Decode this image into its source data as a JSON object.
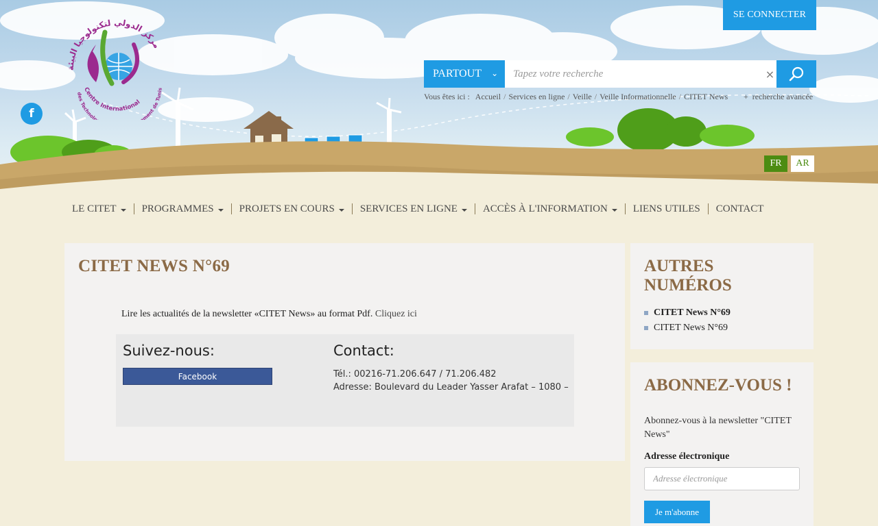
{
  "header": {
    "connect_label": "SE CONNECTER",
    "logo": {
      "arabic_arc": "مركز الدولي لتكنولوجيا البيئة",
      "name_lines": [
        "Centre International",
        "des Technologies de l'Environnement de Tunis"
      ]
    },
    "facebook_icon_glyph": "f",
    "search": {
      "scope_label": "PARTOUT",
      "scope_chevron": "⌄",
      "placeholder": "Tapez votre recherche",
      "clear_glyph": "×"
    },
    "breadcrumb": {
      "label": "Vous êtes ici :",
      "items": [
        "Accueil",
        "Services en ligne",
        "Veille",
        "Veille Informationnelle",
        "CITET News"
      ],
      "separator": "/"
    },
    "advanced_search": {
      "plus": "+",
      "label": "recherche avancée"
    },
    "languages": [
      "FR",
      "AR"
    ]
  },
  "nav": {
    "items": [
      {
        "label": "LE CITET",
        "dropdown": true
      },
      {
        "label": "PROGRAMMES",
        "dropdown": true
      },
      {
        "label": "PROJETS EN COURS",
        "dropdown": true
      },
      {
        "label": "SERVICES EN LIGNE",
        "dropdown": true
      },
      {
        "label": "ACCÈS À L'INFORMATION",
        "dropdown": true
      },
      {
        "label": "LIENS UTILES",
        "dropdown": false
      },
      {
        "label": "CONTACT",
        "dropdown": false
      }
    ]
  },
  "main": {
    "title": "CITET NEWS N°69",
    "intro_text": "Lire les actualités de la newsletter «CITET News» au format Pdf.",
    "intro_link": "Cliquez ici",
    "follow_title": "Suivez-nous:",
    "facebook_button": "Facebook",
    "contact_title": "Contact:",
    "contact_phone": "Tél.: 00216-71.206.647 / 71.206.482",
    "contact_address": "Adresse: Boulevard du Leader Yasser Arafat – 1080 –"
  },
  "sidebar": {
    "other_issues_title": "AUTRES NUMÉROS",
    "issues": [
      "CITET News N°69",
      "CITET News N°69"
    ],
    "subscribe_title": "ABONNEZ-VOUS !",
    "subscribe_text": "Abonnez-vous à la newsletter \"CITET News\"",
    "email_label": "Adresse électronique",
    "email_placeholder": "Adresse électronique",
    "subscribe_button": "Je m'abonne"
  },
  "colors": {
    "accent_blue": "#1f9be3",
    "title_brown": "#8b6a46",
    "lang_green": "#4c8c12",
    "facebook_blue": "#3b5998",
    "page_bg": "#f3eedb"
  }
}
